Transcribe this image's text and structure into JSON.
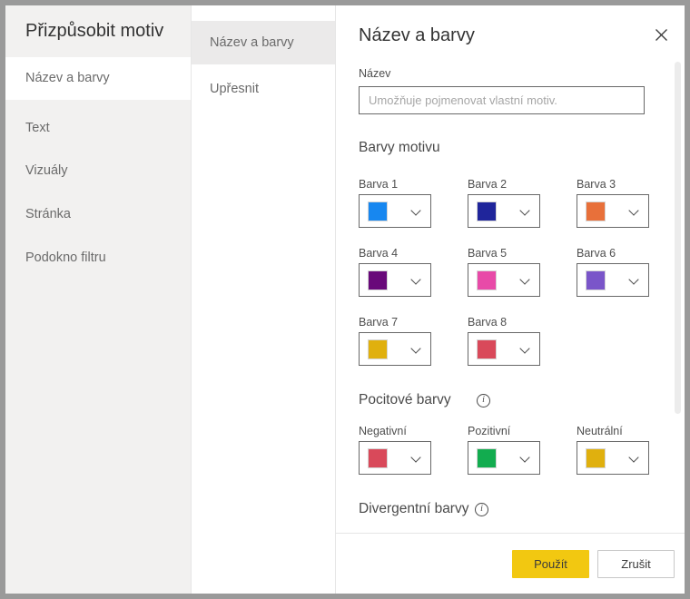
{
  "sidebar": {
    "title": "Přizpůsobit motiv",
    "items": [
      {
        "label": "Název a barvy",
        "selected": true
      },
      {
        "label": "Text",
        "selected": false
      },
      {
        "label": "Vizuály",
        "selected": false
      },
      {
        "label": "Stránka",
        "selected": false
      },
      {
        "label": "Podokno filtru",
        "selected": false
      }
    ]
  },
  "midcol": {
    "items": [
      {
        "label": "Název a barvy",
        "selected": true
      },
      {
        "label": "Upřesnit",
        "selected": false
      }
    ]
  },
  "panel": {
    "title": "Název a barvy",
    "close_icon": "close-icon",
    "name_label": "Název",
    "name_value": "",
    "name_placeholder": "Umožňuje pojmenovat vlastní motiv.",
    "theme_colors_heading": "Barvy motivu",
    "theme_colors": [
      {
        "label": "Barva 1",
        "color": "#1787f0"
      },
      {
        "label": "Barva 2",
        "color": "#1f259b"
      },
      {
        "label": "Barva 3",
        "color": "#e8703a"
      },
      {
        "label": "Barva 4",
        "color": "#69097a"
      },
      {
        "label": "Barva 5",
        "color": "#e84aa8"
      },
      {
        "label": "Barva 6",
        "color": "#7a55c9"
      },
      {
        "label": "Barva 7",
        "color": "#e0b00e"
      },
      {
        "label": "Barva 8",
        "color": "#d9495a"
      }
    ],
    "sentiment_heading": "Pocitové barvy",
    "sentiment_info_icon": "info-icon",
    "sentiment_colors": [
      {
        "label": "Negativní",
        "color": "#d9495a"
      },
      {
        "label": "Pozitivní",
        "color": "#12ac4f"
      },
      {
        "label": "Neutrální",
        "color": "#e0b00e"
      }
    ],
    "divergent_heading": "Divergentní barvy",
    "divergent_info_icon": "info-icon",
    "dropdown_icon": "chevron-down-icon"
  },
  "footer": {
    "apply_label": "Použít",
    "cancel_label": "Zrušit"
  },
  "colors": {
    "accent": "#f2c811",
    "sidebar_bg": "#f2f1f0",
    "selected_bg": "#ebeaea"
  }
}
